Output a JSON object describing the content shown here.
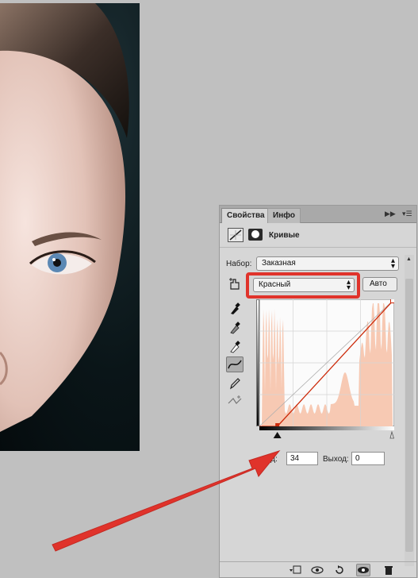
{
  "tabs": {
    "properties": "Свойства",
    "info": "Инфо"
  },
  "panel": {
    "title": "Кривые",
    "preset_label": "Набор:",
    "preset_value": "Заказная",
    "channel_value": "Красный",
    "auto_label": "Авто",
    "input_label": "ход:",
    "input_value": "34",
    "output_label": "Выход:",
    "output_value": "0"
  },
  "curve": {
    "black_point_input": 34,
    "black_point_output": 0,
    "white_point_input": 255,
    "white_point_output": 255
  },
  "colors": {
    "highlight": "#e0332b",
    "curve_line": "#cc2a0a",
    "histogram": "#f7c9b3",
    "panel_bg": "#d6d6d6",
    "canvas_bg": "#c0c0c0"
  },
  "icons": [
    "curves-adjustment-icon",
    "layer-mask-icon",
    "on-image-adjust-icon",
    "black-eyedropper-icon",
    "gray-eyedropper-icon",
    "white-eyedropper-icon",
    "curve-points-icon",
    "pencil-icon",
    "smooth-icon",
    "clip-to-layer-icon",
    "previous-state-icon",
    "reset-icon",
    "visibility-icon",
    "trash-icon"
  ]
}
